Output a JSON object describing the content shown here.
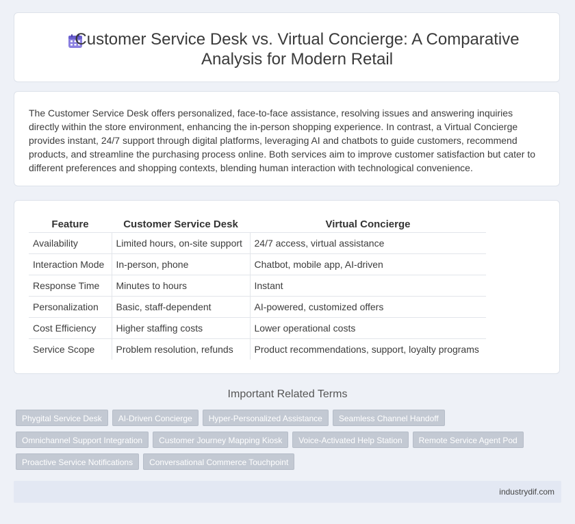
{
  "header": {
    "title": "Customer Service Desk vs. Virtual Concierge: A Comparative Analysis for Modern Retail",
    "icon": "calendar-icon",
    "accent": "#7b6fd6"
  },
  "summary": {
    "text": "The Customer Service Desk offers personalized, face-to-face assistance, resolving issues and answering inquiries directly within the store environment, enhancing the in-person shopping experience. In contrast, a Virtual Concierge provides instant, 24/7 support through digital platforms, leveraging AI and chatbots to guide customers, recommend products, and streamline the purchasing process online. Both services aim to improve customer satisfaction but cater to different preferences and shopping contexts, blending human interaction with technological convenience."
  },
  "table": {
    "headers": [
      "Feature",
      "Customer Service Desk",
      "Virtual Concierge"
    ],
    "rows": [
      [
        "Availability",
        "Limited hours, on-site support",
        "24/7 access, virtual assistance"
      ],
      [
        "Interaction Mode",
        "In-person, phone",
        "Chatbot, mobile app, AI-driven"
      ],
      [
        "Response Time",
        "Minutes to hours",
        "Instant"
      ],
      [
        "Personalization",
        "Basic, staff-dependent",
        "AI-powered, customized offers"
      ],
      [
        "Cost Efficiency",
        "Higher staffing costs",
        "Lower operational costs"
      ],
      [
        "Service Scope",
        "Problem resolution, refunds",
        "Product recommendations, support, loyalty programs"
      ]
    ]
  },
  "related": {
    "heading": "Important Related Terms",
    "tags": [
      "Phygital Service Desk",
      "AI-Driven Concierge",
      "Hyper-Personalized Assistance",
      "Seamless Channel Handoff",
      "Omnichannel Support Integration",
      "Customer Journey Mapping Kiosk",
      "Voice-Activated Help Station",
      "Remote Service Agent Pod",
      "Proactive Service Notifications",
      "Conversational Commerce Touchpoint"
    ]
  },
  "footer": {
    "text": "industrydif.com"
  }
}
